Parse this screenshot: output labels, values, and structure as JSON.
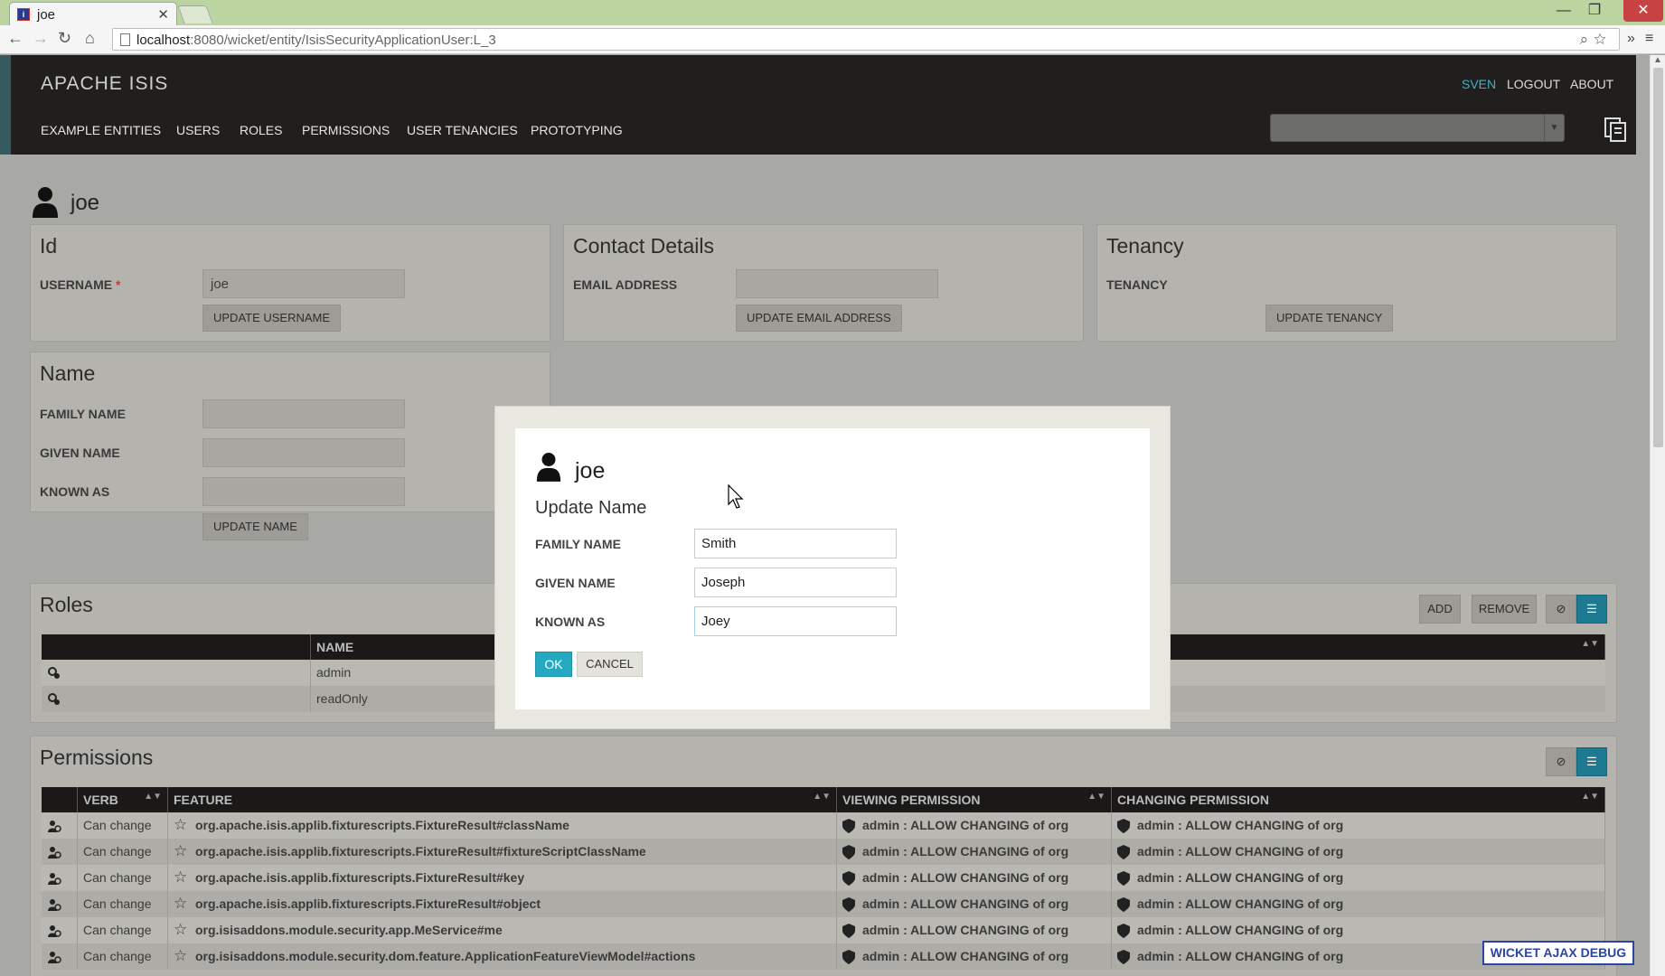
{
  "browser": {
    "tab_title": "joe",
    "favicon_text": "i",
    "url_host": "localhost",
    "url_rest": ":8080/wicket/entity/IsisSecurityApplicationUser:L_3"
  },
  "app": {
    "brand": "APACHE ISIS",
    "menu": [
      "EXAMPLE ENTITIES",
      "USERS",
      "ROLES",
      "PERMISSIONS",
      "USER TENANCIES",
      "PROTOTYPING"
    ],
    "user": "SVEN",
    "logout": "LOGOUT",
    "about": "ABOUT"
  },
  "entity": {
    "title": "joe"
  },
  "panels": {
    "id": {
      "title": "Id",
      "username_label": "USERNAME",
      "required_mark": "*",
      "username_value": "joe",
      "update_button": "UPDATE USERNAME"
    },
    "contact": {
      "title": "Contact Details",
      "email_label": "EMAIL ADDRESS",
      "email_value": "",
      "update_button": "UPDATE EMAIL ADDRESS"
    },
    "tenancy": {
      "title": "Tenancy",
      "tenancy_label": "TENANCY",
      "update_button": "UPDATE TENANCY"
    },
    "name": {
      "title": "Name",
      "family_label": "FAMILY NAME",
      "given_label": "GIVEN NAME",
      "known_label": "KNOWN AS",
      "update_button": "UPDATE NAME"
    }
  },
  "roles": {
    "title": "Roles",
    "add_button": "ADD",
    "remove_button": "REMOVE",
    "header_name": "NAME",
    "rows": [
      "admin",
      "readOnly"
    ]
  },
  "permissions": {
    "title": "Permissions",
    "headers": {
      "verb": "VERB",
      "feature": "FEATURE",
      "viewing": "VIEWING PERMISSION",
      "changing": "CHANGING PERMISSION"
    },
    "rows": [
      {
        "verb": "Can change",
        "feature": "org.apache.isis.applib.fixturescripts.FixtureResult#className",
        "viewing": "admin : ALLOW CHANGING of org",
        "changing": "admin : ALLOW CHANGING of org"
      },
      {
        "verb": "Can change",
        "feature": "org.apache.isis.applib.fixturescripts.FixtureResult#fixtureScriptClassName",
        "viewing": "admin : ALLOW CHANGING of org",
        "changing": "admin : ALLOW CHANGING of org"
      },
      {
        "verb": "Can change",
        "feature": "org.apache.isis.applib.fixturescripts.FixtureResult#key",
        "viewing": "admin : ALLOW CHANGING of org",
        "changing": "admin : ALLOW CHANGING of org"
      },
      {
        "verb": "Can change",
        "feature": "org.apache.isis.applib.fixturescripts.FixtureResult#object",
        "viewing": "admin : ALLOW CHANGING of org",
        "changing": "admin : ALLOW CHANGING of org"
      },
      {
        "verb": "Can change",
        "feature": "org.isisaddons.module.security.app.MeService#me",
        "viewing": "admin : ALLOW CHANGING of org",
        "changing": "admin : ALLOW CHANGING of org"
      },
      {
        "verb": "Can change",
        "feature": "org.isisaddons.module.security.dom.feature.ApplicationFeatureViewModel#actions",
        "viewing": "admin : ALLOW CHANGING of org",
        "changing": "admin : ALLOW CHANGING of org"
      }
    ]
  },
  "modal": {
    "entity_name": "joe",
    "action_title": "Update Name",
    "family_label": "FAMILY NAME",
    "family_value": "Smith",
    "given_label": "GIVEN NAME",
    "given_value": "Joseph",
    "known_label": "KNOWN AS",
    "known_value": "Joey",
    "ok": "OK",
    "cancel": "CANCEL"
  },
  "debug": "WICKET AJAX DEBUG",
  "colors": {
    "accent": "#24a9c1",
    "appbar": "#201f1d",
    "user_link": "#3fb0c9"
  }
}
